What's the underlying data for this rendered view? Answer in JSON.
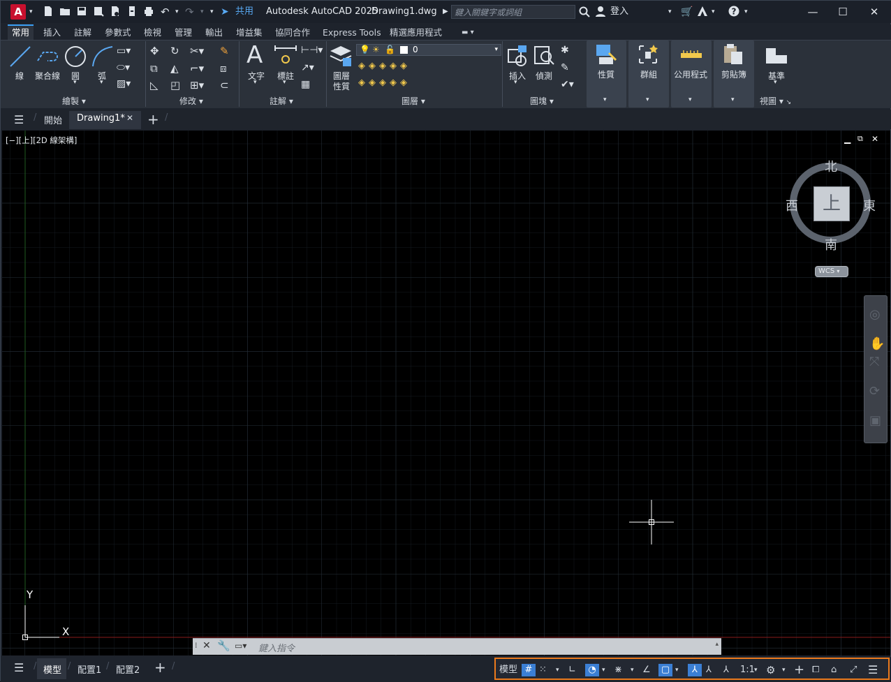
{
  "title": {
    "share_label": "共用",
    "app_name": "Autodesk AutoCAD 2025",
    "file_name": "Drawing1.dwg",
    "search_placeholder": "鍵入關鍵字或詞組",
    "signin_label": "登入"
  },
  "ribbon_tabs": [
    "常用",
    "插入",
    "註解",
    "參數式",
    "檢視",
    "管理",
    "輸出",
    "增益集",
    "協同合作",
    "Express Tools",
    "精選應用程式"
  ],
  "ribbon": {
    "draw": {
      "line": "線",
      "polyline": "聚合線",
      "circle": "圓",
      "arc": "弧",
      "footer": "繪製"
    },
    "modify": {
      "footer": "修改"
    },
    "annotation": {
      "text": "文字",
      "dimension": "標註",
      "footer": "註解"
    },
    "layers": {
      "properties_l1": "圖層",
      "properties_l2": "性質",
      "current_layer": "0",
      "footer": "圖層"
    },
    "block": {
      "insert": "插入",
      "edit": "偵測",
      "footer": "圖塊"
    },
    "properties": {
      "label": "性質"
    },
    "groups": {
      "label": "群組"
    },
    "utilities": {
      "label": "公用程式"
    },
    "clipboard": {
      "label": "剪貼簿"
    },
    "view": {
      "base": "基準",
      "footer": "視圖"
    }
  },
  "doc_tabs": {
    "start": "開始",
    "drawing": "Drawing1*"
  },
  "viewport": {
    "label": "[−][上][2D 線架構]"
  },
  "viewcube": {
    "north": "北",
    "south": "南",
    "east": "東",
    "west": "西",
    "face": "上",
    "wcs": "WCS"
  },
  "ucs": {
    "x": "X",
    "y": "Y"
  },
  "command": {
    "placeholder": "鍵入指令"
  },
  "layout_tabs": {
    "model": "模型",
    "layout1": "配置1",
    "layout2": "配置2"
  },
  "statusbar": {
    "model": "模型",
    "scale": "1:1"
  },
  "colors": {
    "accent": "#3b9ff5",
    "highlight": "#ec7a1c",
    "grid": "#1f2730",
    "x_axis": "#8b1d1d",
    "y_axis": "#1f5a1f"
  }
}
